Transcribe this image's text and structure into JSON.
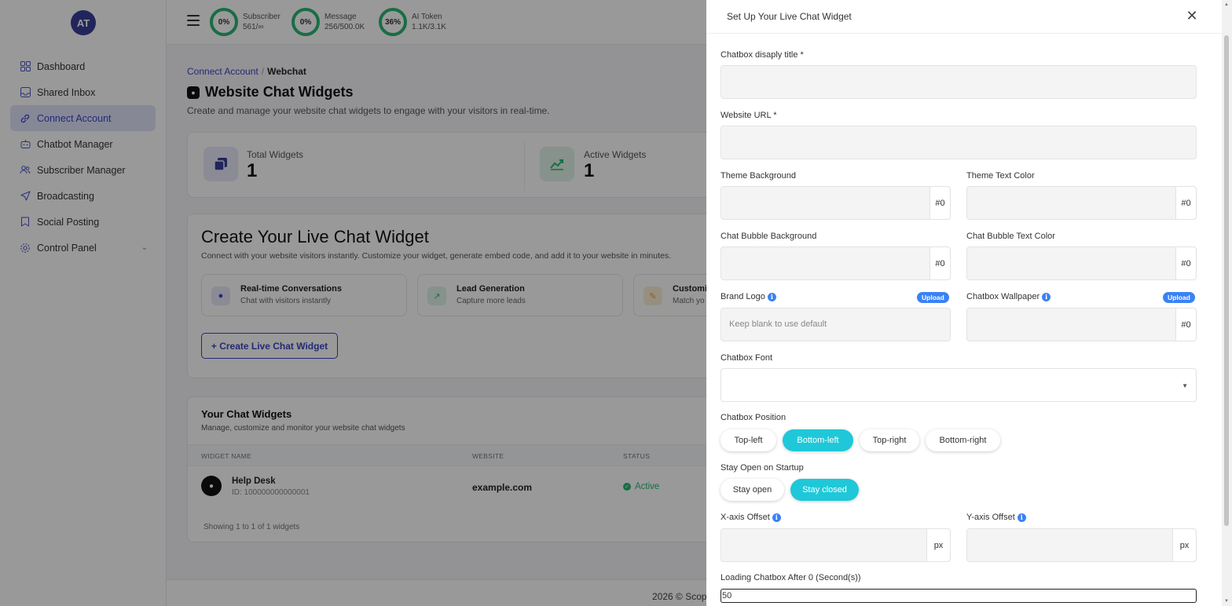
{
  "sidebar": {
    "avatar_initials": "AT",
    "items": [
      {
        "label": "Dashboard",
        "icon": "grid-icon"
      },
      {
        "label": "Shared Inbox",
        "icon": "inbox-icon"
      },
      {
        "label": "Connect Account",
        "icon": "link-icon",
        "active": true
      },
      {
        "label": "Chatbot Manager",
        "icon": "bot-icon"
      },
      {
        "label": "Subscriber Manager",
        "icon": "users-icon"
      },
      {
        "label": "Broadcasting",
        "icon": "send-icon"
      },
      {
        "label": "Social Posting",
        "icon": "bookmark-icon"
      },
      {
        "label": "Control Panel",
        "icon": "gear-icon"
      }
    ]
  },
  "header": {
    "stats": [
      {
        "percent": "0%",
        "label": "Subscriber",
        "value": "561/∞"
      },
      {
        "percent": "0%",
        "label": "Message",
        "value": "256/500.0K"
      },
      {
        "percent": "36%",
        "label": "AI Token",
        "value": "1.1K/3.1K"
      }
    ]
  },
  "breadcrumb": {
    "parent": "Connect Account",
    "separator": "/",
    "current": "Webchat"
  },
  "page": {
    "title": "Website Chat Widgets",
    "subtitle": "Create and manage your website chat widgets to engage with your visitors in real-time."
  },
  "metrics": [
    {
      "label": "Total Widgets",
      "value": "1"
    },
    {
      "label": "Active Widgets",
      "value": "1"
    }
  ],
  "create_card": {
    "title": "Create Your Live Chat Widget",
    "subtitle": "Connect with your website visitors instantly. Customize your widget, generate embed code, and add it to your website in minutes.",
    "features": [
      {
        "title": "Real-time Conversations",
        "desc": "Chat with visitors instantly"
      },
      {
        "title": "Lead Generation",
        "desc": "Capture more leads"
      },
      {
        "title": "Customi",
        "desc": "Match yo"
      }
    ],
    "button_label": "+ Create Live Chat Widget"
  },
  "widgets_list": {
    "title": "Your Chat Widgets",
    "subtitle": "Manage, customize and monitor your website chat widgets",
    "columns": [
      "WIDGET NAME",
      "WEBSITE",
      "STATUS"
    ],
    "rows": [
      {
        "name": "Help Desk",
        "id": "ID: 100000000000001",
        "website": "example.com",
        "status": "Active"
      }
    ],
    "showing": "Showing 1 to 1 of 1 widgets"
  },
  "footer": {
    "text": "2026 © Scop"
  },
  "modal": {
    "title": "Set Up Your Live Chat Widget",
    "fields": {
      "display_title": {
        "label": "Chatbox disaply title *",
        "value": ""
      },
      "website_url": {
        "label": "Website URL *",
        "value": ""
      },
      "theme_bg": {
        "label": "Theme Background",
        "addon": "#0"
      },
      "theme_text": {
        "label": "Theme Text Color",
        "addon": "#0"
      },
      "bubble_bg": {
        "label": "Chat Bubble Background",
        "addon": "#0"
      },
      "bubble_text": {
        "label": "Chat Bubble Text Color",
        "addon": "#0"
      },
      "brand_logo": {
        "label": "Brand Logo",
        "upload": "Upload",
        "placeholder": "Keep blank to use default"
      },
      "wallpaper": {
        "label": "Chatbox Wallpaper",
        "upload": "Upload",
        "addon": "#0"
      },
      "font": {
        "label": "Chatbox Font",
        "value": ""
      },
      "position": {
        "label": "Chatbox Position",
        "options": [
          "Top-left",
          "Bottom-left",
          "Top-right",
          "Bottom-right"
        ],
        "selected": "Bottom-left"
      },
      "startup": {
        "label": "Stay Open on Startup",
        "options": [
          "Stay open",
          "Stay closed"
        ],
        "selected": "Stay closed"
      },
      "x_offset": {
        "label": "X-axis Offset",
        "addon": "px"
      },
      "y_offset": {
        "label": "Y-axis Offset",
        "addon": "px"
      },
      "loading_delay": {
        "label": "Loading Chatbox After 0 (Second(s))",
        "value": "50"
      }
    }
  },
  "colors": {
    "accent": "#3b45c7",
    "teal": "#1ec8d8",
    "success": "#2bb673",
    "info": "#3b82f6"
  }
}
